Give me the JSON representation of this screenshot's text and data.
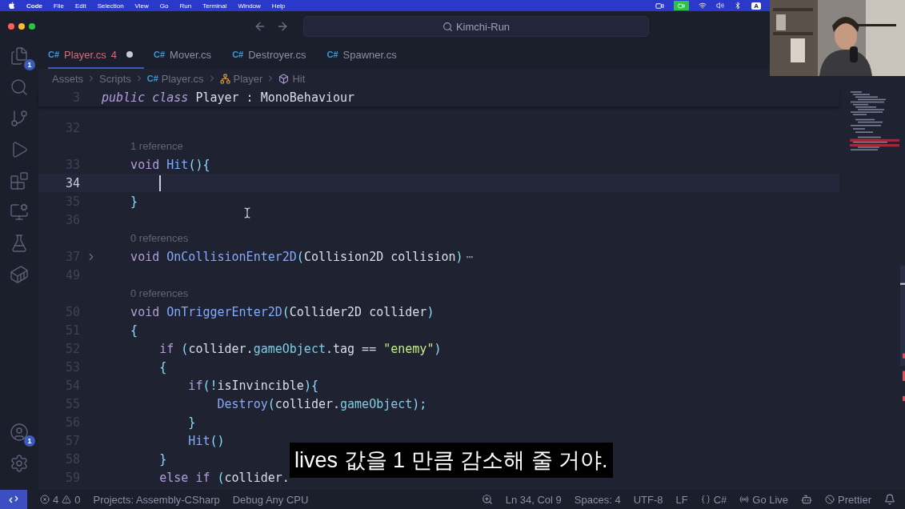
{
  "menubar": {
    "app": "Code",
    "items": [
      "File",
      "Edit",
      "Selection",
      "View",
      "Go",
      "Run",
      "Terminal",
      "Window",
      "Help"
    ],
    "input_source": "A"
  },
  "titlebar": {
    "search": "Kimchi-Run"
  },
  "activity_bar": {
    "top": [
      {
        "kind": "files",
        "badge": "1"
      },
      {
        "kind": "search"
      },
      {
        "kind": "source-control"
      },
      {
        "kind": "run"
      },
      {
        "kind": "extensions"
      },
      {
        "kind": "remote"
      },
      {
        "kind": "testing"
      },
      {
        "kind": "docker"
      }
    ],
    "bottom": [
      {
        "kind": "account",
        "badge": "1"
      },
      {
        "kind": "settings"
      }
    ]
  },
  "tabs": [
    {
      "icon": "C#",
      "label": "Player.cs",
      "problems": "4",
      "modified": true,
      "selected": true
    },
    {
      "icon": "C#",
      "label": "Mover.cs",
      "modified": false,
      "selected": false
    },
    {
      "icon": "C#",
      "label": "Destroyer.cs",
      "modified": false,
      "selected": false
    },
    {
      "icon": "C#",
      "label": "Spawner.cs",
      "modified": false,
      "selected": false
    }
  ],
  "breadcrumb": [
    {
      "kind": "folder",
      "label": "Assets"
    },
    {
      "kind": "folder",
      "label": "Scripts"
    },
    {
      "kind": "file",
      "icon": "C#",
      "label": "Player.cs"
    },
    {
      "kind": "class",
      "label": "Player"
    },
    {
      "kind": "method",
      "label": "Hit"
    }
  ],
  "sticky_line": {
    "number": "3",
    "tokens": [
      {
        "kind": "keyword",
        "text": "public class",
        "italic": true
      },
      {
        "kind": "type",
        "text": " Player : MonoBehaviour"
      }
    ]
  },
  "lines": [
    {
      "kind": "code",
      "number": "32"
    },
    {
      "kind": "lens",
      "text": "1 reference"
    },
    {
      "kind": "code",
      "number": "33",
      "tokens": [
        {
          "kind": "keyword",
          "text": "    void"
        },
        {
          "kind": "func",
          "text": " Hit"
        },
        {
          "kind": "punct",
          "text": "(){"
        }
      ]
    },
    {
      "kind": "code",
      "number": "34",
      "current": true
    },
    {
      "kind": "code",
      "number": "35",
      "tokens": [
        {
          "kind": "punct",
          "text": "    }"
        }
      ]
    },
    {
      "kind": "code",
      "number": "36"
    },
    {
      "kind": "lens",
      "text": "0 references"
    },
    {
      "kind": "code",
      "number": "37",
      "folded": true,
      "ellipsis": "⋯",
      "tokens": [
        {
          "kind": "keyword",
          "text": "    void"
        },
        {
          "kind": "func",
          "text": " OnCollisionEnter2D"
        },
        {
          "kind": "punct",
          "text": "("
        },
        {
          "kind": "type",
          "text": "Collision2D collision"
        },
        {
          "kind": "punct",
          "text": ")"
        }
      ]
    },
    {
      "kind": "code",
      "number": "49"
    },
    {
      "kind": "lens",
      "text": "0 references"
    },
    {
      "kind": "code",
      "number": "50",
      "tokens": [
        {
          "kind": "keyword",
          "text": "    void"
        },
        {
          "kind": "func",
          "text": " OnTriggerEnter2D"
        },
        {
          "kind": "punct",
          "text": "("
        },
        {
          "kind": "type",
          "text": "Collider2D collider"
        },
        {
          "kind": "punct",
          "text": ")"
        }
      ]
    },
    {
      "kind": "code",
      "number": "51",
      "tokens": [
        {
          "kind": "punct",
          "text": "    {"
        }
      ]
    },
    {
      "kind": "code",
      "number": "52",
      "tokens": [
        {
          "kind": "keyword",
          "text": "        if"
        },
        {
          "kind": "punct",
          "text": " ("
        },
        {
          "kind": "type",
          "text": "collider."
        },
        {
          "kind": "prop",
          "text": "gameObject"
        },
        {
          "kind": "type",
          "text": ".tag == "
        },
        {
          "kind": "string",
          "text": "\"enemy\""
        },
        {
          "kind": "punct",
          "text": ")"
        }
      ]
    },
    {
      "kind": "code",
      "number": "53",
      "tokens": [
        {
          "kind": "punct",
          "text": "        {"
        }
      ]
    },
    {
      "kind": "code",
      "number": "54",
      "tokens": [
        {
          "kind": "keyword",
          "text": "            if"
        },
        {
          "kind": "punct",
          "text": "(!"
        },
        {
          "kind": "type",
          "text": "isInvincible"
        },
        {
          "kind": "punct",
          "text": "){"
        }
      ]
    },
    {
      "kind": "code",
      "number": "55",
      "tokens": [
        {
          "kind": "func",
          "text": "                Destroy"
        },
        {
          "kind": "punct",
          "text": "("
        },
        {
          "kind": "type",
          "text": "collider."
        },
        {
          "kind": "prop",
          "text": "gameObject"
        },
        {
          "kind": "punct",
          "text": ");"
        }
      ]
    },
    {
      "kind": "code",
      "number": "56",
      "tokens": [
        {
          "kind": "punct",
          "text": "            }"
        }
      ]
    },
    {
      "kind": "code",
      "number": "57",
      "tokens": [
        {
          "kind": "func",
          "text": "            Hit"
        },
        {
          "kind": "punct",
          "text": "()"
        }
      ]
    },
    {
      "kind": "code",
      "number": "58",
      "tokens": [
        {
          "kind": "punct",
          "text": "        }"
        }
      ]
    },
    {
      "kind": "code",
      "number": "59",
      "tokens": [
        {
          "kind": "keyword",
          "text": "        else if"
        },
        {
          "kind": "punct",
          "text": " ("
        },
        {
          "kind": "type",
          "text": "collider."
        }
      ]
    }
  ],
  "subtitle": "lives 값을 1 만큼 감소해 줄 거야.",
  "status_bar": {
    "errors": "4",
    "warnings": "0",
    "left": [
      "Projects: Assembly-CSharp",
      "Debug Any CPU"
    ],
    "position": "Ln 34, Col 9",
    "spaces": "Spaces: 4",
    "encoding": "UTF-8",
    "eol": "LF",
    "language": "C#",
    "live": "Go Live",
    "formatter": "Prettier"
  }
}
